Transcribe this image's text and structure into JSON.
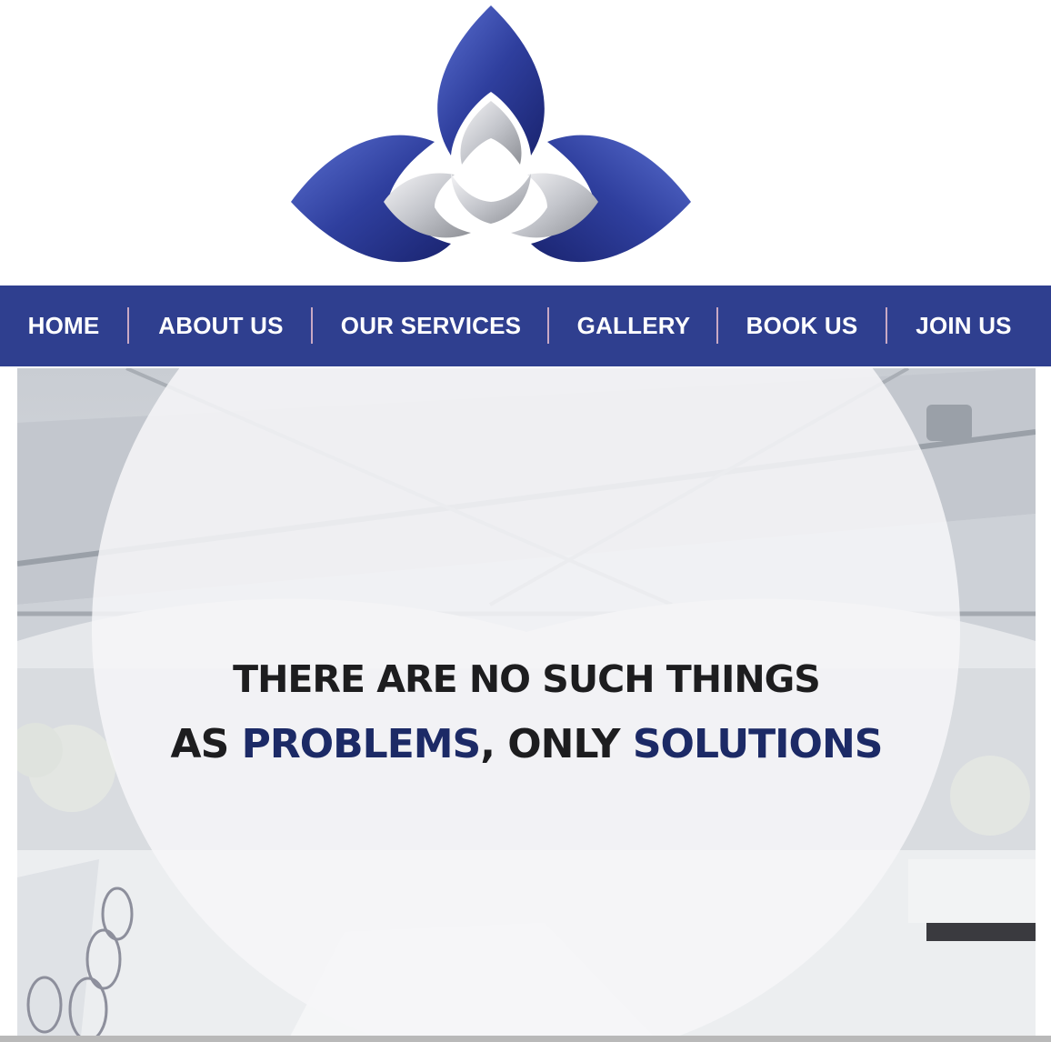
{
  "logo": {
    "icon": "trefoil-lotus-logo"
  },
  "colors": {
    "nav_bg": "#2f3f8f",
    "accent": "#1c2a66",
    "logo_blue": "#2f3f9e",
    "logo_silver": "#c4c6cc"
  },
  "nav": {
    "items": [
      {
        "label": "HOME"
      },
      {
        "label": "ABOUT US"
      },
      {
        "label": "OUR SERVICES"
      },
      {
        "label": "GALLERY"
      },
      {
        "label": "BOOK US"
      },
      {
        "label": "JOIN US"
      }
    ]
  },
  "hero": {
    "line1": "THERE ARE NO SUCH THINGS",
    "line2_a": "AS ",
    "line2_b": "PROBLEMS",
    "line2_c": ", ONLY ",
    "line2_d": "SOLUTIONS"
  }
}
